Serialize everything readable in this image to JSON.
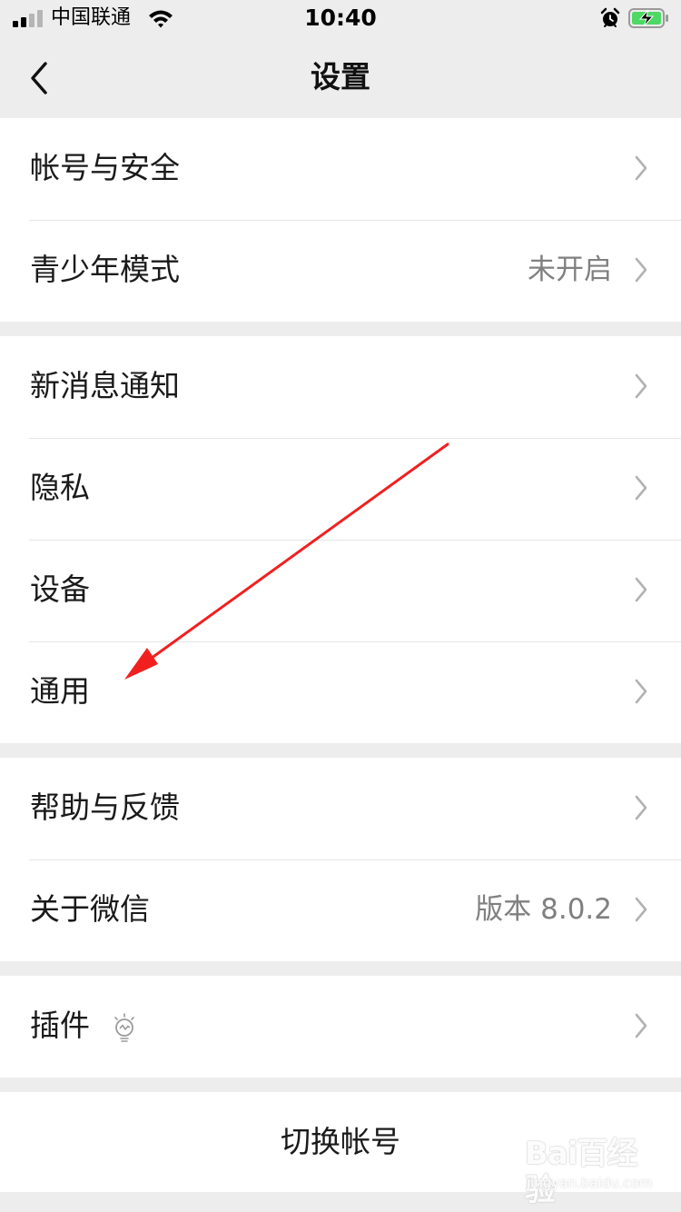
{
  "status_bar": {
    "carrier": "中国联通",
    "time": "10:40",
    "battery_charging": true,
    "icons": [
      "signal-icon",
      "wifi-icon",
      "alarm-icon",
      "battery-icon"
    ]
  },
  "nav": {
    "title": "设置",
    "back_icon": "chevron-left-icon"
  },
  "groups": {
    "account": {
      "items": [
        {
          "label": "帐号与安全",
          "value": ""
        },
        {
          "label": "青少年模式",
          "value": "未开启"
        }
      ]
    },
    "settings": {
      "items": [
        {
          "label": "新消息通知",
          "value": ""
        },
        {
          "label": "隐私",
          "value": ""
        },
        {
          "label": "设备",
          "value": ""
        },
        {
          "label": "通用",
          "value": ""
        }
      ]
    },
    "about": {
      "items": [
        {
          "label": "帮助与反馈",
          "value": ""
        },
        {
          "label": "关于微信",
          "value": "版本 8.0.2"
        }
      ]
    },
    "plugins": {
      "items": [
        {
          "label": "插件",
          "value": "",
          "icon": "lightbulb-icon"
        }
      ]
    }
  },
  "switch_account": {
    "label": "切换帐号"
  },
  "watermark": {
    "logo": "Bai百经验",
    "url": "jingyan.baidu.com"
  },
  "colors": {
    "background": "#ededed",
    "cell": "#ffffff",
    "text": "#1a1a1a",
    "secondary_text": "#808080",
    "chevron": "#b2b2b2",
    "annotation_arrow": "#f21f1f",
    "battery_fill": "#4cd964"
  }
}
